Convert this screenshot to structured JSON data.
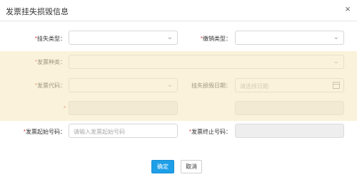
{
  "dialog": {
    "title": "发票挂失损毁信息",
    "close_symbol": "×"
  },
  "form": {
    "lost_type": {
      "required": "*",
      "label": "挂失类型：",
      "value": ""
    },
    "cancel_type": {
      "required": "*",
      "label": "缴销类型：",
      "value": ""
    },
    "invoice_type": {
      "required": "*",
      "label": "发票种类：",
      "value": ""
    },
    "invoice_code": {
      "required": "*",
      "label": "发票代码：",
      "value": ""
    },
    "lost_date": {
      "label": "挂失损毁日期：",
      "placeholder": "请选择日期"
    },
    "row_three_left": {
      "required": "*",
      "label": "",
      "value": ""
    },
    "row_three_right": {
      "label": "",
      "value": ""
    },
    "invoice_start": {
      "required": "*",
      "label": "发票起始号码：",
      "placeholder": "请输入发票起始号码"
    },
    "invoice_end": {
      "required": "*",
      "label": "发票终止号码：",
      "value": ""
    }
  },
  "buttons": {
    "confirm": "确定",
    "cancel": "取消"
  }
}
